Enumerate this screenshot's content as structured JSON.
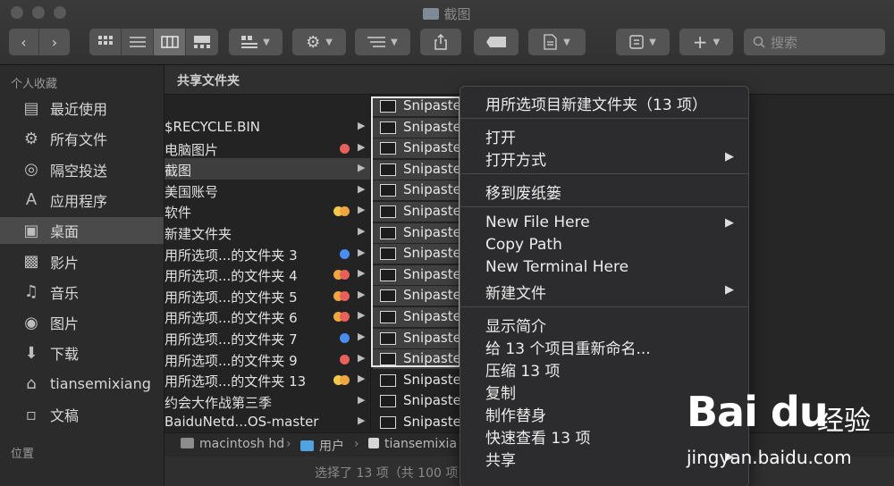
{
  "window": {
    "title": "截图"
  },
  "toolbar": {
    "search_placeholder": "搜索"
  },
  "sidebar": {
    "favorites_header": "个人收藏",
    "items": [
      {
        "label": "最近使用",
        "icon": "recents-icon"
      },
      {
        "label": "所有文件",
        "icon": "all-files-icon"
      },
      {
        "label": "隔空投送",
        "icon": "airdrop-icon"
      },
      {
        "label": "应用程序",
        "icon": "applications-icon"
      },
      {
        "label": "桌面",
        "icon": "desktop-icon",
        "selected": true
      },
      {
        "label": "影片",
        "icon": "movies-icon"
      },
      {
        "label": "音乐",
        "icon": "music-icon"
      },
      {
        "label": "图片",
        "icon": "pictures-icon"
      },
      {
        "label": "下载",
        "icon": "downloads-icon"
      },
      {
        "label": "tiansemixiang",
        "icon": "home-icon"
      },
      {
        "label": "文稿",
        "icon": "documents-icon"
      }
    ],
    "locations_header": "位置"
  },
  "content": {
    "header": "共享文件夹",
    "column1": [
      {
        "label": "$RECYCLE.BIN",
        "tags": []
      },
      {
        "label": "电脑图片",
        "tags": [
          "#e8605a"
        ]
      },
      {
        "label": "截图",
        "tags": [],
        "selected": true
      },
      {
        "label": "美国账号",
        "tags": []
      },
      {
        "label": "软件",
        "tags": [
          "#f2c94c",
          "#f0a640"
        ]
      },
      {
        "label": "新建文件夹",
        "tags": []
      },
      {
        "label": "用所选项...的文件夹 3",
        "tags": [
          "#4a8cf0"
        ]
      },
      {
        "label": "用所选项...的文件夹 4",
        "tags": [
          "#f0a640",
          "#e8605a"
        ]
      },
      {
        "label": "用所选项...的文件夹 5",
        "tags": [
          "#f0a640",
          "#e8605a"
        ]
      },
      {
        "label": "用所选项...的文件夹 6",
        "tags": [
          "#f0a640",
          "#e8605a"
        ]
      },
      {
        "label": "用所选项...的文件夹 7",
        "tags": [
          "#4a8cf0"
        ]
      },
      {
        "label": "用所选项...的文件夹 9",
        "tags": [
          "#e8605a"
        ]
      },
      {
        "label": "用所选项...的文件夹 13",
        "tags": [
          "#f2c94c",
          "#f0a640"
        ]
      },
      {
        "label": "约会大作战第三季",
        "tags": []
      },
      {
        "label": "BaiduNetd...OS-master",
        "tags": []
      }
    ],
    "column2": [
      "Snipaste",
      "Snipaste",
      "Snipaste",
      "Snipaste",
      "Snipaste",
      "Snipaste",
      "Snipaste",
      "Snipaste",
      "Snipaste",
      "Snipaste",
      "Snipaste",
      "Snipaste",
      "Snipaste",
      "Snipaste",
      "Snipaste",
      "Snipaste"
    ]
  },
  "pathbar": [
    "macintosh hd",
    "用户",
    "tiansemixia"
  ],
  "status": "选择了 13 项（共 100 项",
  "context_menu": {
    "groups": [
      [
        {
          "label": "用所选项目新建文件夹（13 项）",
          "submenu": false
        }
      ],
      [
        {
          "label": "打开",
          "submenu": false
        },
        {
          "label": "打开方式",
          "submenu": true
        }
      ],
      [
        {
          "label": "移到废纸篓",
          "submenu": false
        }
      ],
      [
        {
          "label": "New File Here",
          "submenu": true
        },
        {
          "label": "Copy Path",
          "submenu": false
        },
        {
          "label": "New Terminal Here",
          "submenu": false
        },
        {
          "label": "新建文件",
          "submenu": true
        }
      ],
      [
        {
          "label": "显示简介",
          "submenu": false
        },
        {
          "label": "给 13 个项目重新命名...",
          "submenu": false
        },
        {
          "label": "压缩 13 项",
          "submenu": false
        },
        {
          "label": "复制",
          "submenu": false
        },
        {
          "label": "制作替身",
          "submenu": false
        },
        {
          "label": "快速查看 13 项",
          "submenu": false
        },
        {
          "label": "共享",
          "submenu": true
        }
      ]
    ]
  },
  "watermark": {
    "logo": "Bai du",
    "cn": "经验",
    "url": "jingyan.baidu.com"
  }
}
